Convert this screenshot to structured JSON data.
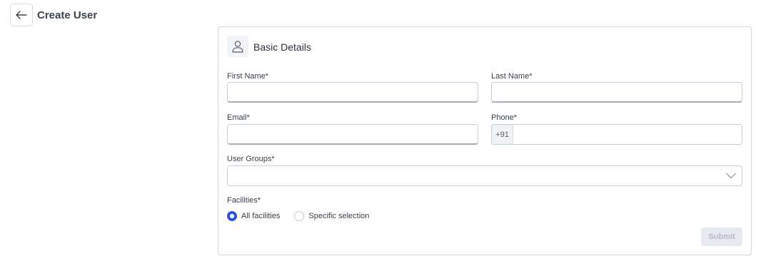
{
  "header": {
    "title": "Create User",
    "back_icon": "arrow-left-icon"
  },
  "card": {
    "title": "Basic Details",
    "icon": "user-icon"
  },
  "form": {
    "first_name": {
      "label": "First Name*",
      "value": ""
    },
    "last_name": {
      "label": "Last Name*",
      "value": ""
    },
    "email": {
      "label": "Email*",
      "value": ""
    },
    "phone": {
      "label": "Phone*",
      "prefix": "+91",
      "value": ""
    },
    "user_groups": {
      "label": "User Groups*",
      "value": "",
      "icon": "chevron-down-icon"
    },
    "facilities": {
      "label": "Facilities*",
      "options": [
        {
          "label": "All facilities",
          "checked": true
        },
        {
          "label": "Specific selection",
          "checked": false
        }
      ]
    },
    "submit_label": "Submit"
  },
  "colors": {
    "accent": "#2e55d9",
    "disabled_button_bg": "#e6e9ef",
    "disabled_button_text": "#b5bbc6"
  }
}
